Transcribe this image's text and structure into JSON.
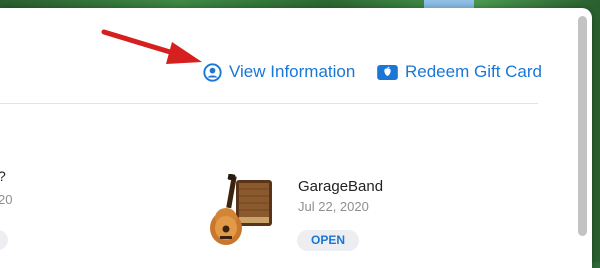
{
  "header": {
    "view_information_label": "View Information",
    "redeem_gift_card_label": "Redeem Gift Card"
  },
  "left_item_partial": {
    "name_fragment": "?",
    "date_fragment": "20"
  },
  "purchases": [
    {
      "name": "GarageBand",
      "date": "Jul 22, 2020",
      "button": "OPEN"
    }
  ],
  "colors": {
    "link": "#1a77d6",
    "annotation_arrow": "#d61f1f"
  },
  "icons": {
    "view_information": "person-circle-icon",
    "redeem_gift_card": "gift-card-icon",
    "app": "garageband-guitar-icon"
  }
}
